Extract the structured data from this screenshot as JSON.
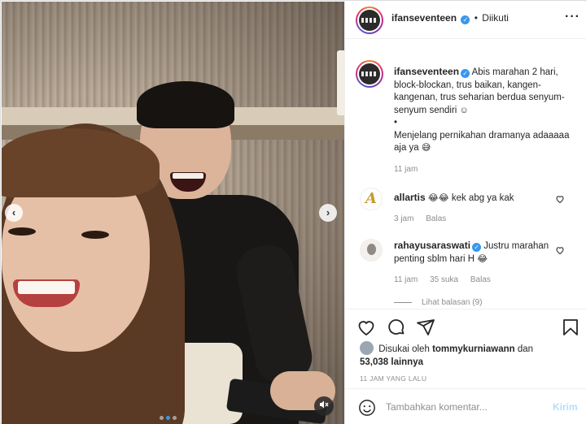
{
  "post": {
    "username": "ifanseventeen",
    "separator": "•",
    "follow_status": "Diikuti",
    "more_icon": "more-horizontal-icon",
    "caption": {
      "username": "ifanseventeen",
      "text_line1": "Abis marahan 2 hari, block-blockan, trus baikan, kangen-kangenan, trus seharian berdua senyum-senyum sendiri",
      "emoji1": "☺",
      "bullet": "•",
      "text_line2": "Menjelang pernikahan dramanya adaaaaa aja ya",
      "emoji2": "😅",
      "time": "11 jam"
    },
    "comments": [
      {
        "username": "allartis",
        "emojis": "😂😂",
        "text": "kek abg ya kak",
        "time": "3 jam",
        "reply": "Balas"
      },
      {
        "username": "rahayusaraswati",
        "text": "Justru marahan penting sblm hari H",
        "emoji": "😂",
        "time": "11 jam",
        "likes": "35 suka",
        "reply": "Balas",
        "view_replies": "Lihat balasan (9)"
      }
    ],
    "liked_by_prefix": "Disukai oleh",
    "liked_by_user": "tommykurniawann",
    "liked_by_and": "dan",
    "liked_by_count": "53,038 lainnya",
    "posted_time": "11 JAM YANG LALU",
    "comment_placeholder": "Tambahkan komentar...",
    "post_button": "Kirim"
  },
  "carousel": {
    "slides": 3,
    "active": 1
  },
  "colors": {
    "accent_blue": "#3897f0",
    "muted_text": "#8e8e8e",
    "post_button_disabled": "#b2dffc"
  }
}
